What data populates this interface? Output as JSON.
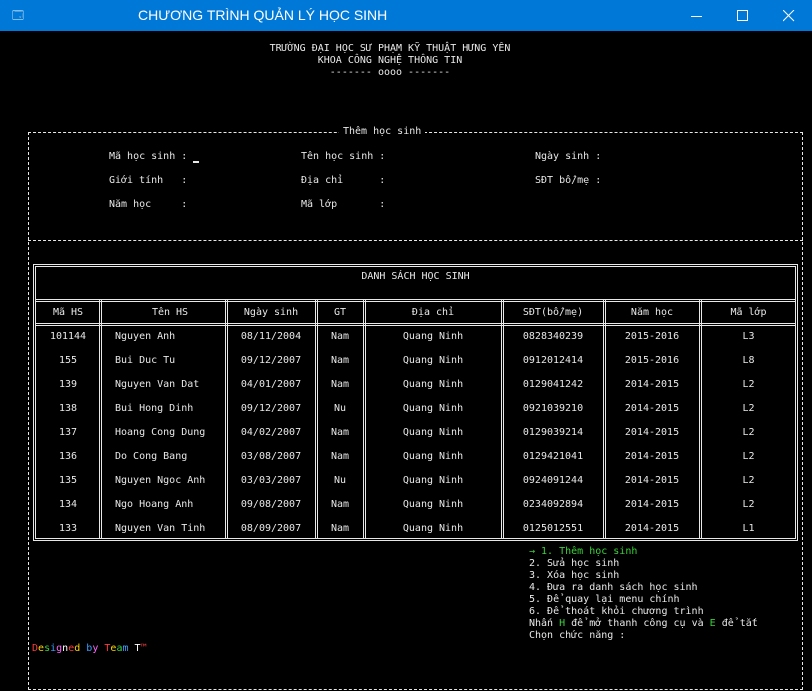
{
  "window": {
    "title": "CHƯƠNG TRÌNH QUẢN LÝ HỌC SINH",
    "icon": "terminal-icon"
  },
  "header": {
    "line1": "TRƯỜNG ĐẠI HỌC SƯ PHẠM KỸ THUẬT HƯNG YÊN",
    "line2": "KHOA CÔNG NGHỆ THÔNG TIN",
    "line3": "------- oooo -------"
  },
  "form": {
    "legend": "Thêm học sinh",
    "fields": {
      "ma_hs": "Mã học sinh :",
      "ten_hs": "Tên học sinh :",
      "ngay_sinh": "Ngày sinh :",
      "gioi_tinh": "Giới tính   :",
      "dia_chi": "Địa chỉ      :",
      "sdt": "SĐT bố/mẹ :",
      "nam_hoc": "Năm học     :",
      "ma_lop": "Mã lớp       :"
    }
  },
  "table": {
    "title": "DANH SÁCH HỌC SINH",
    "headers": [
      "Mã HS",
      "Tên HS",
      "Ngày sinh",
      "GT",
      "Địa chỉ",
      "SĐT(bố/mẹ)",
      "Năm học",
      "Mã lớp"
    ],
    "rows": [
      [
        "101144",
        "Nguyen Anh",
        "08/11/2004",
        "Nam",
        "Quang Ninh",
        "0828340239",
        "2015-2016",
        "L3"
      ],
      [
        "155",
        "Bui Duc Tu",
        "09/12/2007",
        "Nam",
        "Quang Ninh",
        "0912012414",
        "2015-2016",
        "L8"
      ],
      [
        "139",
        "Nguyen Van Dat",
        "04/01/2007",
        "Nam",
        "Quang Ninh",
        "0129041242",
        "2014-2015",
        "L2"
      ],
      [
        "138",
        "Bui Hong Dinh",
        "09/12/2007",
        "Nu",
        "Quang Ninh",
        "0921039210",
        "2014-2015",
        "L2"
      ],
      [
        "137",
        "Hoang Cong Dung",
        "04/02/2007",
        "Nam",
        "Quang Ninh",
        "0129039214",
        "2014-2015",
        "L2"
      ],
      [
        "136",
        "Do Cong Bang",
        "03/08/2007",
        "Nam",
        "Quang Ninh",
        "0129421041",
        "2014-2015",
        "L2"
      ],
      [
        "135",
        "Nguyen Ngoc Anh",
        "03/03/2007",
        "Nu",
        "Quang Ninh",
        "0924091244",
        "2014-2015",
        "L2"
      ],
      [
        "134",
        "Ngo Hoang Anh",
        "09/08/2007",
        "Nam",
        "Quang Ninh",
        "0234092894",
        "2014-2015",
        "L2"
      ],
      [
        "133",
        "Nguyen Van Tinh",
        "08/09/2007",
        "Nam",
        "Quang Ninh",
        "0125012551",
        "2014-2015",
        "L1"
      ]
    ]
  },
  "menu": {
    "items": [
      "→ 1. Thêm học sinh",
      "2. Sửa học sinh",
      "3. Xóa học sinh",
      "4. Đưa ra danh sách học sinh",
      "5. Để quay lại menu chính",
      "6. Để thoát khỏi chương trình"
    ],
    "hint_prefix": "Nhấn ",
    "hint_key1": "H",
    "hint_mid": " để mở thanh công cụ và ",
    "hint_key2": "E",
    "hint_suffix": " để tắt",
    "prompt": "Chọn chức năng :"
  },
  "footer": {
    "signature": "Designed by Team T™",
    "signature_colors": [
      "#ff3b3b",
      "#ffd400",
      "#3ad13a",
      "#3aa0ff",
      "#ff66ff",
      "#ffffff"
    ]
  },
  "colors": {
    "titlebar": "#0078d7",
    "background": "#000000",
    "text": "#e8e8e8",
    "highlight": "#3ad13a"
  }
}
